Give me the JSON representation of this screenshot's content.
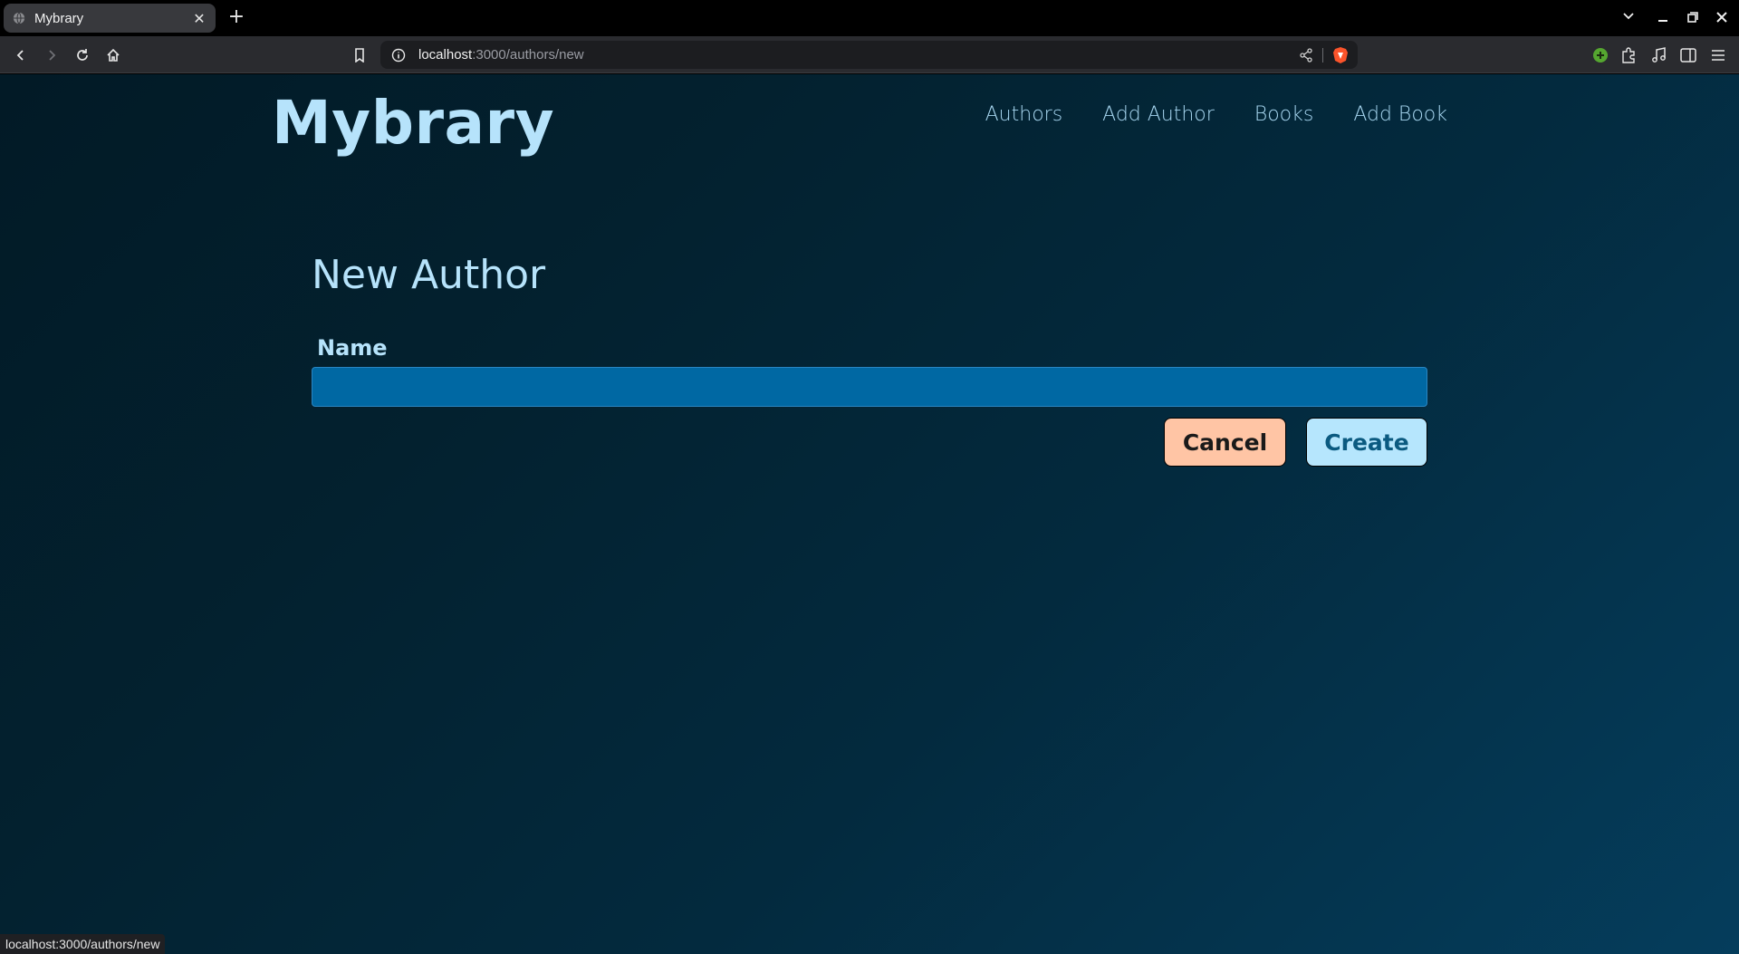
{
  "browser": {
    "tab": {
      "title": "Mybrary",
      "close": "✕"
    },
    "new_tab": "+",
    "url": {
      "host": "localhost",
      "path": ":3000/authors/new"
    },
    "status_url": "localhost:3000/authors/new",
    "window_controls": {
      "dropdown": "⌄",
      "minimize": "—",
      "restore": "❐",
      "close": "✕"
    }
  },
  "site": {
    "logo": "Mybrary",
    "nav": [
      "Authors",
      "Add Author",
      "Books",
      "Add Book"
    ]
  },
  "form": {
    "title": "New Author",
    "name_label": "Name",
    "name_value": "",
    "cancel_label": "Cancel",
    "create_label": "Create"
  },
  "colors": {
    "accent_light": "#b6e3fb",
    "input_bg": "#0068a3",
    "cancel_bg": "#ffc5a5",
    "create_bg": "#b6e6fd"
  }
}
